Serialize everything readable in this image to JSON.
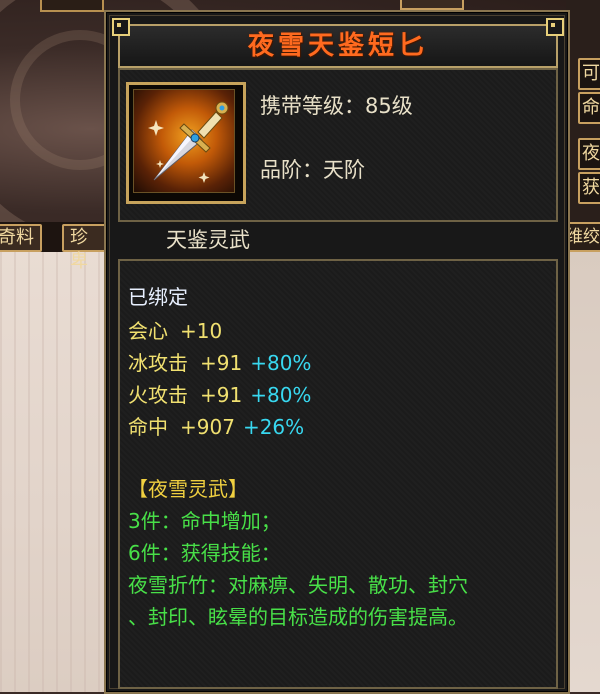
{
  "background": {
    "left_tabs": [
      "奇料",
      "珍卑"
    ],
    "right_tab": "维绞",
    "right_buttons": [
      "可",
      "命",
      "夜",
      "获"
    ]
  },
  "item": {
    "name": "夜雪天鉴短匕",
    "carry_level_label": "携带等级：",
    "carry_level_value": "85级",
    "grade_label": "品阶：",
    "grade_value": "天阶",
    "category": "天鉴灵武",
    "icon": "dagger-icon"
  },
  "stats": {
    "bound": "已绑定",
    "lines": [
      {
        "name": "会心",
        "value": "+10",
        "percent": ""
      },
      {
        "name": "冰攻击",
        "value": "+91",
        "percent": "+80%"
      },
      {
        "name": "火攻击",
        "value": "+91",
        "percent": "+80%"
      },
      {
        "name": "命中",
        "value": "+907",
        "percent": "+26%"
      }
    ]
  },
  "set": {
    "title": "【夜雪灵武】",
    "bonus_3": "3件：命中增加；",
    "bonus_6": "6件：获得技能：",
    "skill_line1": "夜雪折竹：对麻痹、失明、散功、封穴",
    "skill_line2": "、封印、眩晕的目标造成的伤害提高。"
  },
  "colors": {
    "title": "#ff6a1f",
    "stat_yellow": "#f0e070",
    "percent_cyan": "#38d8f0",
    "set_green": "#48e048",
    "set_title_gold": "#f0d040",
    "frame_gold": "#c7a35b"
  }
}
